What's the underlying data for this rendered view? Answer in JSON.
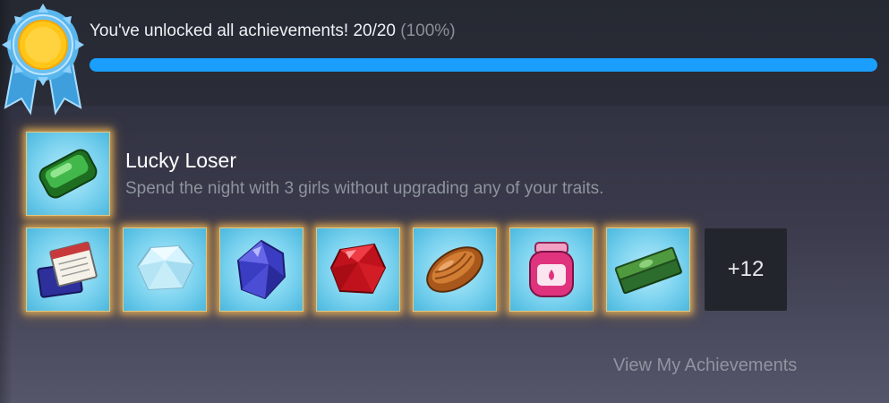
{
  "progress": {
    "text": "You've unlocked all achievements! 20/20",
    "percent_text": "(100%)",
    "fraction": 1.0
  },
  "featured": {
    "name": "Lucky Loser",
    "description": "Spend the night with 3 girls without upgrading any of your traits.",
    "icon": "green-gem-icon"
  },
  "achievements": [
    {
      "icon": "calendar-book-icon"
    },
    {
      "icon": "diamond-icon"
    },
    {
      "icon": "blue-gem-icon"
    },
    {
      "icon": "red-gem-icon"
    },
    {
      "icon": "bronze-stone-icon"
    },
    {
      "icon": "pink-jar-icon"
    },
    {
      "icon": "green-cash-icon"
    }
  ],
  "more_count": "+12",
  "view_link": "View My Achievements",
  "colors": {
    "accent": "#1a9fff",
    "bar_track": "#2a3d66",
    "glow": "#ffb84a",
    "tile_bg": "#7cd3ef"
  }
}
